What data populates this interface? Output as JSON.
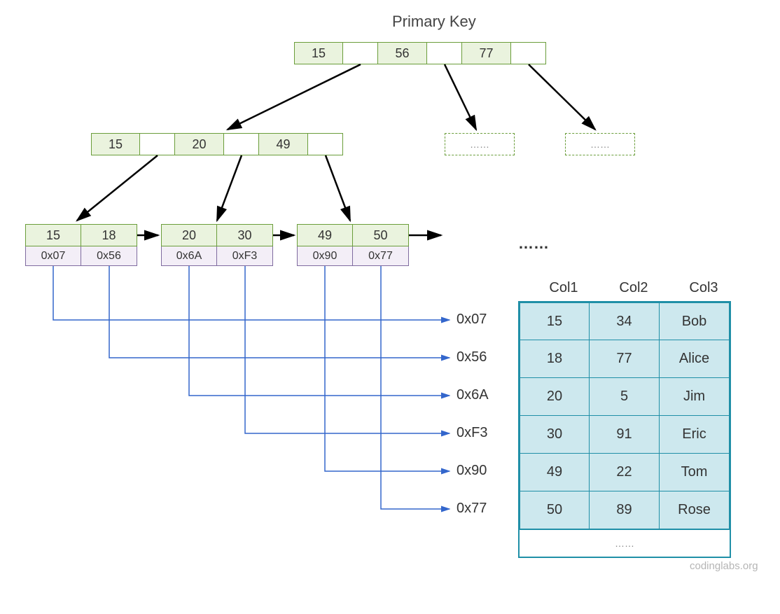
{
  "title": "Primary Key",
  "colors": {
    "green_border": "#6A9D3A",
    "green_fill": "#EAF3DE",
    "purple_border": "#7F6B9F",
    "purple_fill": "#F3EEF7",
    "teal_border": "#1F8FA7",
    "teal_fill": "#CDE8EE",
    "blue_line": "#3366CC",
    "black": "#000000"
  },
  "root": {
    "keys": [
      "15",
      "56",
      "77"
    ]
  },
  "level2": {
    "keys": [
      "15",
      "20",
      "49"
    ]
  },
  "dashed_placeholder": "……",
  "leaves": [
    {
      "keys": [
        "15",
        "18"
      ],
      "addrs": [
        "0x07",
        "0x56"
      ]
    },
    {
      "keys": [
        "20",
        "30"
      ],
      "addrs": [
        "0x6A",
        "0xF3"
      ]
    },
    {
      "keys": [
        "49",
        "50"
      ],
      "addrs": [
        "0x90",
        "0x77"
      ]
    }
  ],
  "leaf_ellipsis": "……",
  "addr_labels": [
    "0x07",
    "0x56",
    "0x6A",
    "0xF3",
    "0x90",
    "0x77"
  ],
  "table": {
    "headers": [
      "Col1",
      "Col2",
      "Col3"
    ],
    "rows": [
      [
        "15",
        "34",
        "Bob"
      ],
      [
        "18",
        "77",
        "Alice"
      ],
      [
        "20",
        "5",
        "Jim"
      ],
      [
        "30",
        "91",
        "Eric"
      ],
      [
        "49",
        "22",
        "Tom"
      ],
      [
        "50",
        "89",
        "Rose"
      ]
    ],
    "footer": "……"
  },
  "credit": "codinglabs.org"
}
